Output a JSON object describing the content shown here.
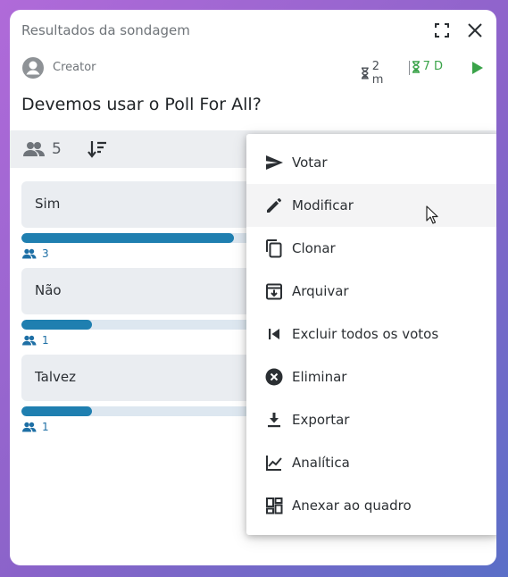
{
  "header": {
    "title": "Resultados da sondagem",
    "creator": "Creator",
    "timer_elapsed": "2 m",
    "timer_remaining": "7 D"
  },
  "poll": {
    "question": "Devemos usar o Poll For All?",
    "participants": "5",
    "options": [
      {
        "label": "Sim",
        "votes": "3",
        "share": 0.6
      },
      {
        "label": "Não",
        "votes": "1",
        "share": 0.2
      },
      {
        "label": "Talvez",
        "votes": "1",
        "share": 0.2
      }
    ]
  },
  "menu": {
    "items": [
      {
        "label": "Votar",
        "icon": "send-icon"
      },
      {
        "label": "Modificar",
        "icon": "pencil-icon"
      },
      {
        "label": "Clonar",
        "icon": "copy-icon"
      },
      {
        "label": "Arquivar",
        "icon": "archive-icon"
      },
      {
        "label": "Excluir todos os votos",
        "icon": "skip-previous-icon"
      },
      {
        "label": "Eliminar",
        "icon": "close-circle-icon"
      },
      {
        "label": "Exportar",
        "icon": "download-icon"
      },
      {
        "label": "Analítica",
        "icon": "chart-line-icon"
      },
      {
        "label": "Anexar ao quadro",
        "icon": "dashboard-icon"
      }
    ],
    "hovered": "Modificar"
  },
  "colors": {
    "accent": "#1f7fb0",
    "timer_green": "#3aa349",
    "toolbar_bg": "#eceef1"
  }
}
